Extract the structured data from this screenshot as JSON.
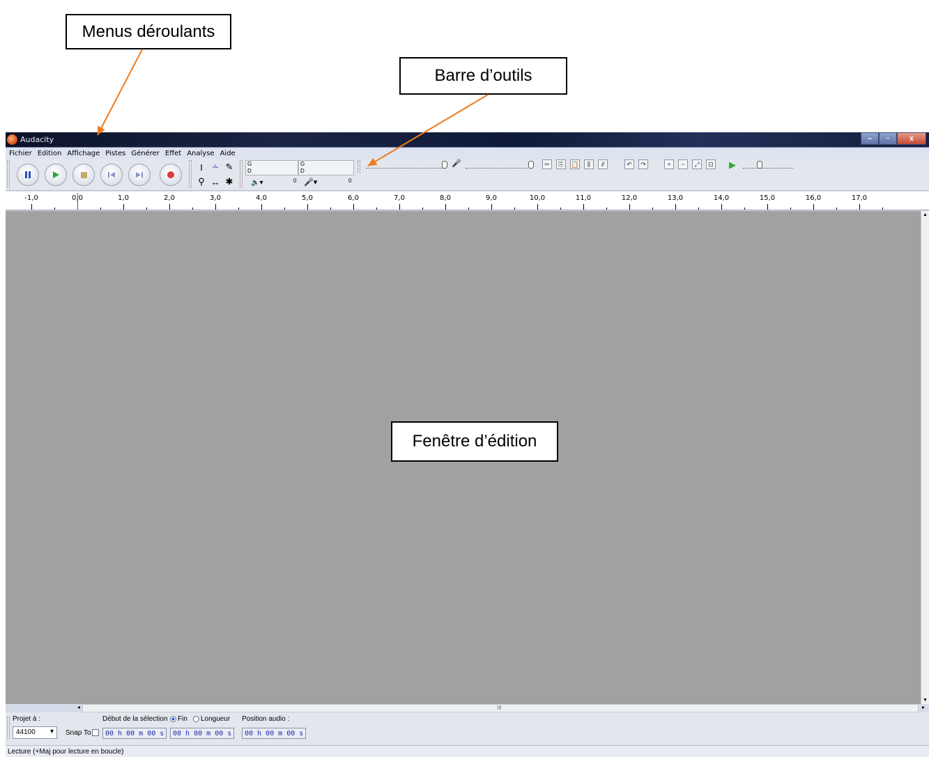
{
  "annotations": {
    "menus": "Menus déroulants",
    "toolbar": "Barre d’outils",
    "edit_window": "Fenêtre d’édition"
  },
  "window": {
    "title": "Audacity",
    "controls": [
      "–",
      "▫",
      "x"
    ]
  },
  "menu": [
    "Fichier",
    "Edition",
    "Affichage",
    "Pistes",
    "Générer",
    "Effet",
    "Analyse",
    "Aide"
  ],
  "transport": {
    "buttons": [
      "pause",
      "play",
      "stop",
      "skip-start",
      "skip-end",
      "record"
    ]
  },
  "meters": {
    "channel_left": "G",
    "channel_right": "D",
    "zero_output": "0",
    "zero_input": "0"
  },
  "ruler": {
    "labels": [
      "-1,0",
      "0,0",
      "1,0",
      "2,0",
      "3,0",
      "4,0",
      "5,0",
      "6,0",
      "7,0",
      "8,0",
      "9,0",
      "10,0",
      "11,0",
      "12,0",
      "13,0",
      "14,0",
      "15,0",
      "16,0",
      "17,0"
    ]
  },
  "hscroll": {
    "grip": "III"
  },
  "selection_bar": {
    "project_rate_label": "Projet à :",
    "project_rate_value": "44100",
    "snap_to_label": "Snap To",
    "selection_start_label": "Début de la sélection",
    "end_label": "Fin",
    "length_label": "Longueur",
    "audio_position_label": "Position audio :",
    "time_start": "00 h 00 m 00 s",
    "time_end": "00 h 00 m 00 s",
    "time_audio": "00 h 00 m 00 s"
  },
  "status": "Lecture (+Maj pour lecture en boucle)"
}
